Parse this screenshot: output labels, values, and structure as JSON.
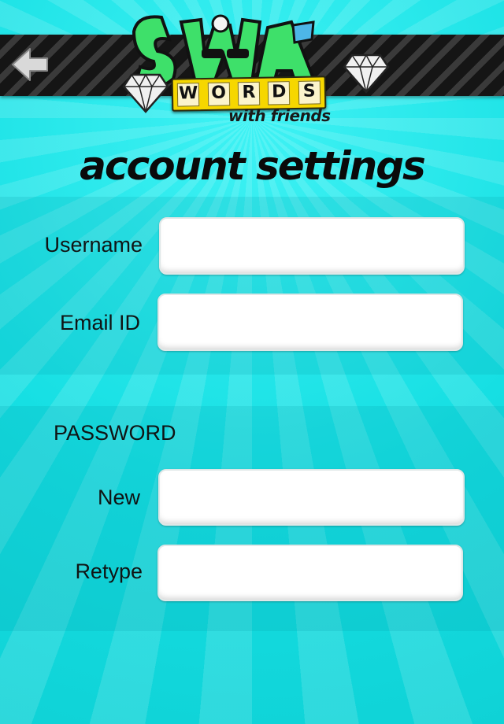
{
  "header": {
    "back_icon": "back-arrow-icon",
    "logo": {
      "main_word": "SWAG",
      "tiles": [
        "W",
        "O",
        "R",
        "D",
        "S"
      ],
      "subtitle": "with friends"
    }
  },
  "page": {
    "title": "account settings"
  },
  "account": {
    "username_label": "Username",
    "username_value": "",
    "email_label": "Email ID",
    "email_value": ""
  },
  "password": {
    "heading": "PASSWORD",
    "new_label": "New",
    "new_value": "",
    "retype_label": "Retype",
    "retype_value": ""
  },
  "colors": {
    "background": "#15e3e6",
    "stripe_dark": "#151515",
    "field_bg": "#ffffff",
    "tile_bg": "#f6d700"
  }
}
